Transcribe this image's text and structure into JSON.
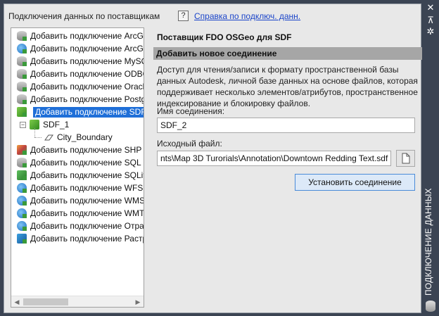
{
  "header": {
    "title": "Подключения данных по поставщикам",
    "help_icon_glyph": "?",
    "help_link": "Справка по подключ. данн."
  },
  "sidebar": {
    "title": "ПОДКЛЮЧЕНИЕ ДАННЫХ",
    "icons": [
      "close-icon",
      "pin-icon",
      "settings-icon",
      "data-connect-icon"
    ]
  },
  "tree": {
    "items": [
      {
        "label": "Добавить подключение ArcGI",
        "icon": "database-icon"
      },
      {
        "label": "Добавить подключение ArcGI",
        "icon": "globe-icon"
      },
      {
        "label": "Добавить подключение MySQ",
        "icon": "database-icon"
      },
      {
        "label": "Добавить подключение ODBC",
        "icon": "database-icon"
      },
      {
        "label": "Добавить подключение Oracl",
        "icon": "database-icon"
      },
      {
        "label": "Добавить подключение Postg",
        "icon": "database-icon"
      },
      {
        "label": "Добавить подключение SDF",
        "icon": "sdf-icon",
        "selected": true
      },
      {
        "label": "SDF_1",
        "icon": "sdf-icon",
        "child": true
      },
      {
        "label": "City_Boundary",
        "icon": "polygon-icon",
        "grandchild": true
      },
      {
        "label": "Добавить подключение SHP",
        "icon": "shp-icon"
      },
      {
        "label": "Добавить подключение SQL S",
        "icon": "database-icon"
      },
      {
        "label": "Добавить подключение SQLit",
        "icon": "sqlite-icon"
      },
      {
        "label": "Добавить подключение WFS",
        "icon": "globe-icon"
      },
      {
        "label": "Добавить подключение WMS",
        "icon": "globe-icon"
      },
      {
        "label": "Добавить подключение WMT",
        "icon": "globe-icon"
      },
      {
        "label": "Добавить подключение Отра",
        "icon": "globe-icon"
      },
      {
        "label": "Добавить подключение Растр",
        "icon": "raster-icon"
      }
    ]
  },
  "form": {
    "provider_title": "Поставщик FDO OSGeo для SDF",
    "section_title": "Добавить новое соединение",
    "description": "Доступ для чтения/записи к формату пространственной базы данных Autodesk, личной базе данных на основе файлов, которая поддерживает несколько элементов/атрибутов, пространственное индексирование и блокировку файлов.",
    "connection_name_label": "Имя соединения:",
    "connection_name_value": "SDF_2",
    "source_file_label": "Исходный файл:",
    "source_file_value": "nts\\Map 3D Turorials\\Annotation\\Downtown Redding Text.sdf",
    "connect_button": "Установить соединение"
  }
}
